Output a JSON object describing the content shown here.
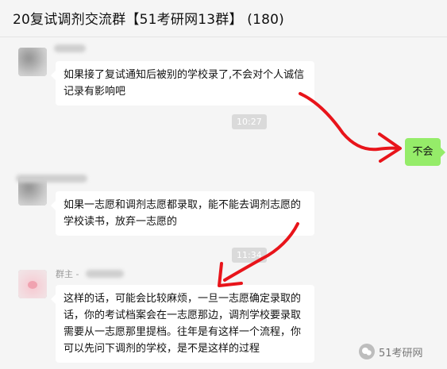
{
  "window": {
    "title": "20复试调剂交流群【51考研网13群】 (180)"
  },
  "messages": [
    {
      "text": "如果接了复试通知后被别的学校录了,不会对个人诚信记录有影响吧"
    },
    {
      "text": "不会"
    },
    {
      "text": "如果一志愿和调剂志愿都录取，能不能去调剂志愿的学校读书，放弃一志愿的"
    },
    {
      "sender_prefix": "群主 - ",
      "text": "这样的话，可能会比较麻烦，一旦一志愿确定录取的话，你的考试档案会在一志愿那边，调剂学校要录取需要从一志愿那里提档。往年是有这样一个流程，你可以先问下调剂的学校，是不是这样的过程"
    }
  ],
  "timestamps": [
    "10:27",
    "11:34"
  ],
  "annotation_color": "#e8141a",
  "watermark": {
    "icon": "wechat-official-account-icon",
    "text": "51考研网"
  }
}
